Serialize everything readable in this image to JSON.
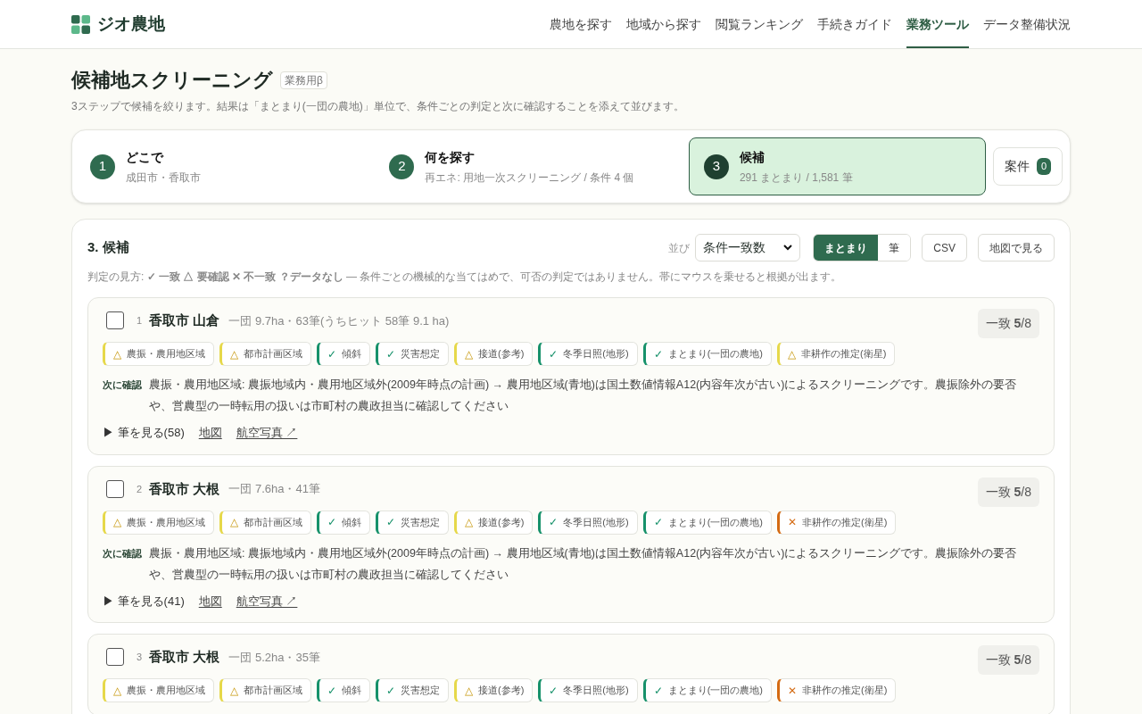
{
  "brand": "ジオ農地",
  "nav": [
    {
      "label": "農地を探す",
      "selected": false
    },
    {
      "label": "地域から探す",
      "selected": false
    },
    {
      "label": "閲覧ランキング",
      "selected": false
    },
    {
      "label": "手続きガイド",
      "selected": false
    },
    {
      "label": "業務ツール",
      "selected": true
    },
    {
      "label": "データ整備状況",
      "selected": false
    }
  ],
  "page": {
    "title": "候補地スクリーニング",
    "badge": "業務用β",
    "description": "3ステップで候補を絞ります。結果は「まとまり(一団の農地)」単位で、条件ごとの判定と次に確認することを添えて並びます。"
  },
  "steps": [
    {
      "number": "1",
      "title": "どこで",
      "detail": "成田市・香取市",
      "selected": false
    },
    {
      "number": "2",
      "title": "何を探す",
      "detail": "再エネ: 用地一次スクリーニング / 条件 4 個",
      "selected": false
    },
    {
      "number": "3",
      "title": "候補",
      "detail": "291 まとまり / 1,581 筆",
      "selected": true
    }
  ],
  "cases_button": {
    "label": "案件",
    "count": "0"
  },
  "results": {
    "heading": "3. 候補",
    "sort_label": "並び",
    "sort_value": "条件一致数",
    "unit_toggle": [
      {
        "label": "まとまり",
        "selected": true
      },
      {
        "label": "筆",
        "selected": false
      }
    ],
    "buttons": [
      "CSV",
      "地図で見る"
    ],
    "legend": "判定の見方: **✓ 一致** **△ 要確認** **✕ 不一致** **？データなし** — 条件ごとの機械的な当てはめで、可否の判定ではありません。帯にマウスを乗せると根拠が出ます。",
    "items": [
      {
        "checked": false,
        "index": "1",
        "name": "香取市 山倉",
        "summary": "一団 9.7ha・63筆(うちヒット 58筆 9.1 ha)",
        "score": "一致 **5**/8",
        "chips": [
          {
            "kind": "warn",
            "mark": "△",
            "label": "農振・農用地区域"
          },
          {
            "kind": "warn",
            "mark": "△",
            "label": "都市計画区域"
          },
          {
            "kind": "ok",
            "mark": "✓",
            "label": "傾斜"
          },
          {
            "kind": "ok",
            "mark": "✓",
            "label": "災害想定"
          },
          {
            "kind": "warn",
            "mark": "△",
            "label": "接道(参考)"
          },
          {
            "kind": "ok",
            "mark": "✓",
            "label": "冬季日照(地形)"
          },
          {
            "kind": "ok",
            "mark": "✓",
            "label": "まとまり(一団の農地)"
          },
          {
            "kind": "warn",
            "mark": "△",
            "label": "非耕作の推定(衛星)"
          }
        ],
        "next_label": "次に確認",
        "next_text": "農振・農用地区域: 農振地域内・農用地区域外(2009年時点の計画) → 農用地区域(青地)は国土数値情報A12(内容年次が古い)によるスクリーニングです。農振除外の要否や、営農型の一時転用の扱いは市町村の農政担当に確認してください",
        "links": [
          {
            "kind": "toggle",
            "label": "▶ 筆を見る(58)"
          },
          {
            "kind": "link",
            "label": "地図"
          },
          {
            "kind": "link",
            "label": "航空写真 ↗"
          }
        ]
      },
      {
        "checked": false,
        "index": "2",
        "name": "香取市 大根",
        "summary": "一団 7.6ha・41筆",
        "score": "一致 **5**/8",
        "chips": [
          {
            "kind": "warn",
            "mark": "△",
            "label": "農振・農用地区域"
          },
          {
            "kind": "warn",
            "mark": "△",
            "label": "都市計画区域"
          },
          {
            "kind": "ok",
            "mark": "✓",
            "label": "傾斜"
          },
          {
            "kind": "ok",
            "mark": "✓",
            "label": "災害想定"
          },
          {
            "kind": "warn",
            "mark": "△",
            "label": "接道(参考)"
          },
          {
            "kind": "ok",
            "mark": "✓",
            "label": "冬季日照(地形)"
          },
          {
            "kind": "ok",
            "mark": "✓",
            "label": "まとまり(一団の農地)"
          },
          {
            "kind": "ng",
            "mark": "✕",
            "label": "非耕作の推定(衛星)"
          }
        ],
        "next_label": "次に確認",
        "next_text": "農振・農用地区域: 農振地域内・農用地区域外(2009年時点の計画) → 農用地区域(青地)は国土数値情報A12(内容年次が古い)によるスクリーニングです。農振除外の要否や、営農型の一時転用の扱いは市町村の農政担当に確認してください",
        "links": [
          {
            "kind": "toggle",
            "label": "▶ 筆を見る(41)"
          },
          {
            "kind": "link",
            "label": "地図"
          },
          {
            "kind": "link",
            "label": "航空写真 ↗"
          }
        ]
      },
      {
        "checked": false,
        "index": "3",
        "name": "香取市 大根",
        "summary": "一団 5.2ha・35筆",
        "score": "一致 **5**/8",
        "chips": [
          {
            "kind": "warn",
            "mark": "△",
            "label": "農振・農用地区域"
          },
          {
            "kind": "warn",
            "mark": "△",
            "label": "都市計画区域"
          },
          {
            "kind": "ok",
            "mark": "✓",
            "label": "傾斜"
          },
          {
            "kind": "ok",
            "mark": "✓",
            "label": "災害想定"
          },
          {
            "kind": "warn",
            "mark": "△",
            "label": "接道(参考)"
          },
          {
            "kind": "ok",
            "mark": "✓",
            "label": "冬季日照(地形)"
          },
          {
            "kind": "ok",
            "mark": "✓",
            "label": "まとまり(一団の農地)"
          },
          {
            "kind": "ng",
            "mark": "✕",
            "label": "非耕作の推定(衛星)"
          }
        ]
      }
    ]
  }
}
